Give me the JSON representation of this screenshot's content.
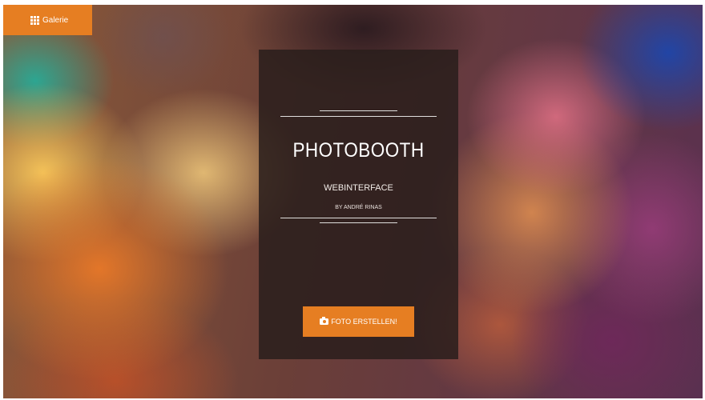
{
  "nav": {
    "gallery_label": "Galerie",
    "gallery_icon": "grid-icon"
  },
  "card": {
    "title": "PHOTOBOOTH",
    "subtitle": "WEBINTERFACE",
    "author": "BY ANDRÉ RINAS",
    "button_label": "FOTO ERSTELLEN!",
    "button_icon": "camera-icon"
  },
  "colors": {
    "accent": "#e67e22",
    "card_background": "#2a1e1c"
  }
}
